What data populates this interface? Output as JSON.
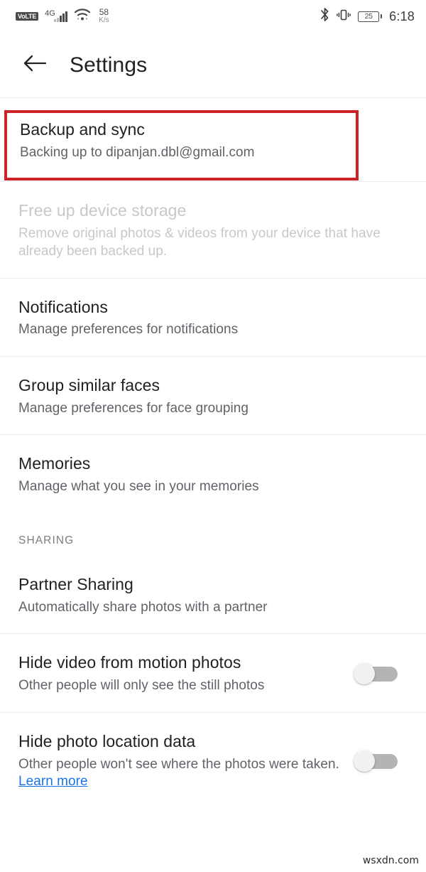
{
  "status_bar": {
    "volte_label": "VoLTE",
    "network_generation": "4G",
    "network_speed_value": "58",
    "network_speed_unit": "K/s",
    "bluetooth_icon": "bluetooth-icon",
    "vibrate_icon": "vibrate-icon",
    "battery_level": "25",
    "time": "6:18"
  },
  "toolbar": {
    "back_icon": "back-arrow-icon",
    "title": "Settings"
  },
  "highlight_color": "#cc2229",
  "link_color": "#1a73e8",
  "settings": [
    {
      "name": "backup-and-sync",
      "title": "Backup and sync",
      "subtitle": "Backing up to dipanjan.dbl@gmail.com",
      "highlighted": true,
      "disabled": false,
      "toggle": null
    },
    {
      "name": "free-up-device-storage",
      "title": "Free up device storage",
      "subtitle": "Remove original photos & videos from your device that have already been backed up.",
      "highlighted": false,
      "disabled": true,
      "toggle": null
    },
    {
      "name": "notifications",
      "title": "Notifications",
      "subtitle": "Manage preferences for notifications",
      "highlighted": false,
      "disabled": false,
      "toggle": null
    },
    {
      "name": "group-similar-faces",
      "title": "Group similar faces",
      "subtitle": "Manage preferences for face grouping",
      "highlighted": false,
      "disabled": false,
      "toggle": null
    },
    {
      "name": "memories",
      "title": "Memories",
      "subtitle": "Manage what you see in your memories",
      "highlighted": false,
      "disabled": false,
      "toggle": null
    }
  ],
  "sharing_section": {
    "header": "SHARING",
    "items": [
      {
        "name": "partner-sharing",
        "title": "Partner Sharing",
        "subtitle": "Automatically share photos with a partner",
        "toggle": null
      },
      {
        "name": "hide-video-from-motion-photos",
        "title": "Hide video from motion photos",
        "subtitle": "Other people will only see the still photos",
        "toggle": "off"
      },
      {
        "name": "hide-photo-location-data",
        "title": "Hide photo location data",
        "subtitle_part1": "Other people won't see where the photos were taken. ",
        "subtitle_link": "Learn more",
        "toggle": "off"
      }
    ]
  },
  "watermark": "wsxdn.com"
}
